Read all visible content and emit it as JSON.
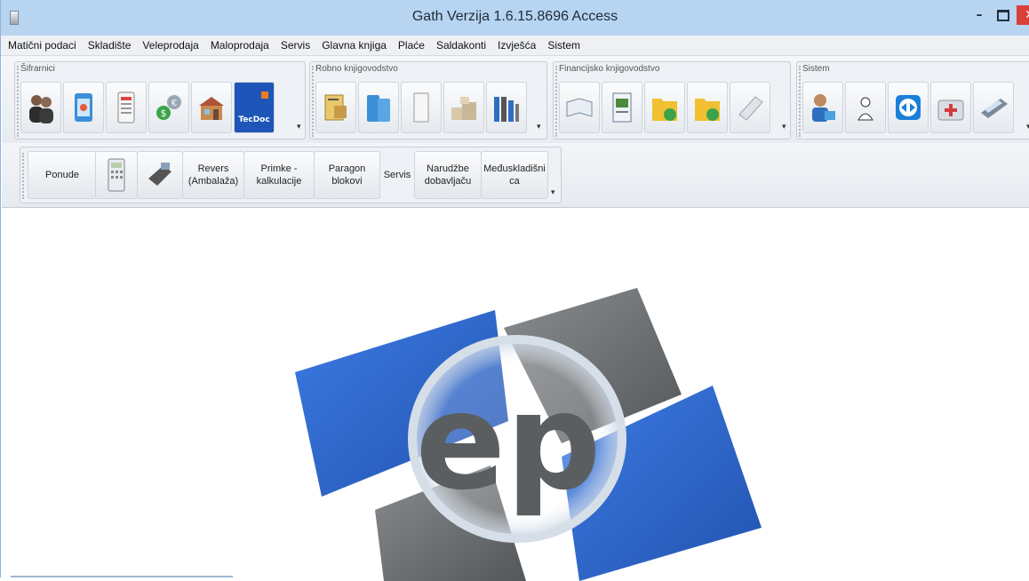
{
  "window": {
    "title": "Gath Verzija 1.6.15.8696 Access",
    "controls": {
      "minimize": "–",
      "close": "✕"
    }
  },
  "menu": [
    "Matični podaci",
    "Skladište",
    "Veleprodaja",
    "Maloprodaja",
    "Servis",
    "Glavna knjiga",
    "Plaće",
    "Saldakonti",
    "Izvješća",
    "Sistem"
  ],
  "ribbon": {
    "groups": [
      {
        "label": "Šifrarnici",
        "icons": [
          "users-icon",
          "box-icon",
          "calendar-document-icon",
          "money-exchange-icon",
          "store-building-icon",
          "tecdoc-logo"
        ],
        "tecdoc_text": "TecDoc"
      },
      {
        "label": "Robno knjigovodstvo",
        "icons": [
          "clipboard-boxes-icon",
          "boxes-icon",
          "door-icon",
          "warehouse-boxes-icon",
          "shelves-icon"
        ]
      },
      {
        "label": "Financijsko knjigovodstvo",
        "icons": [
          "open-book-icon",
          "ledger-icon",
          "folder-download-icon",
          "folder-upload-icon",
          "cheque-icon"
        ]
      },
      {
        "label": "Sistem",
        "icons": [
          "user-admin-icon",
          "person-icon",
          "teamviewer-icon",
          "first-aid-kit-icon",
          "scanner-icon"
        ]
      }
    ],
    "dropdown_glyph": "▾",
    "row2": [
      {
        "label": "Ponude"
      },
      {
        "icon": "calculator-icon"
      },
      {
        "icon": "cash-register-icon"
      },
      {
        "label": "Revers\n(Ambalaža)"
      },
      {
        "label": "Primke -\nkalkulacije"
      },
      {
        "label": "Paragon\nblokovi"
      },
      {
        "label": "Servis"
      },
      {
        "label": "Narudžbe\ndobavljaču"
      },
      {
        "label": "Međuskladišni\nca"
      }
    ]
  },
  "logo": {
    "text": "ep",
    "colors": {
      "blue": "#1f5fd0",
      "gray": "#6a6d70"
    }
  }
}
